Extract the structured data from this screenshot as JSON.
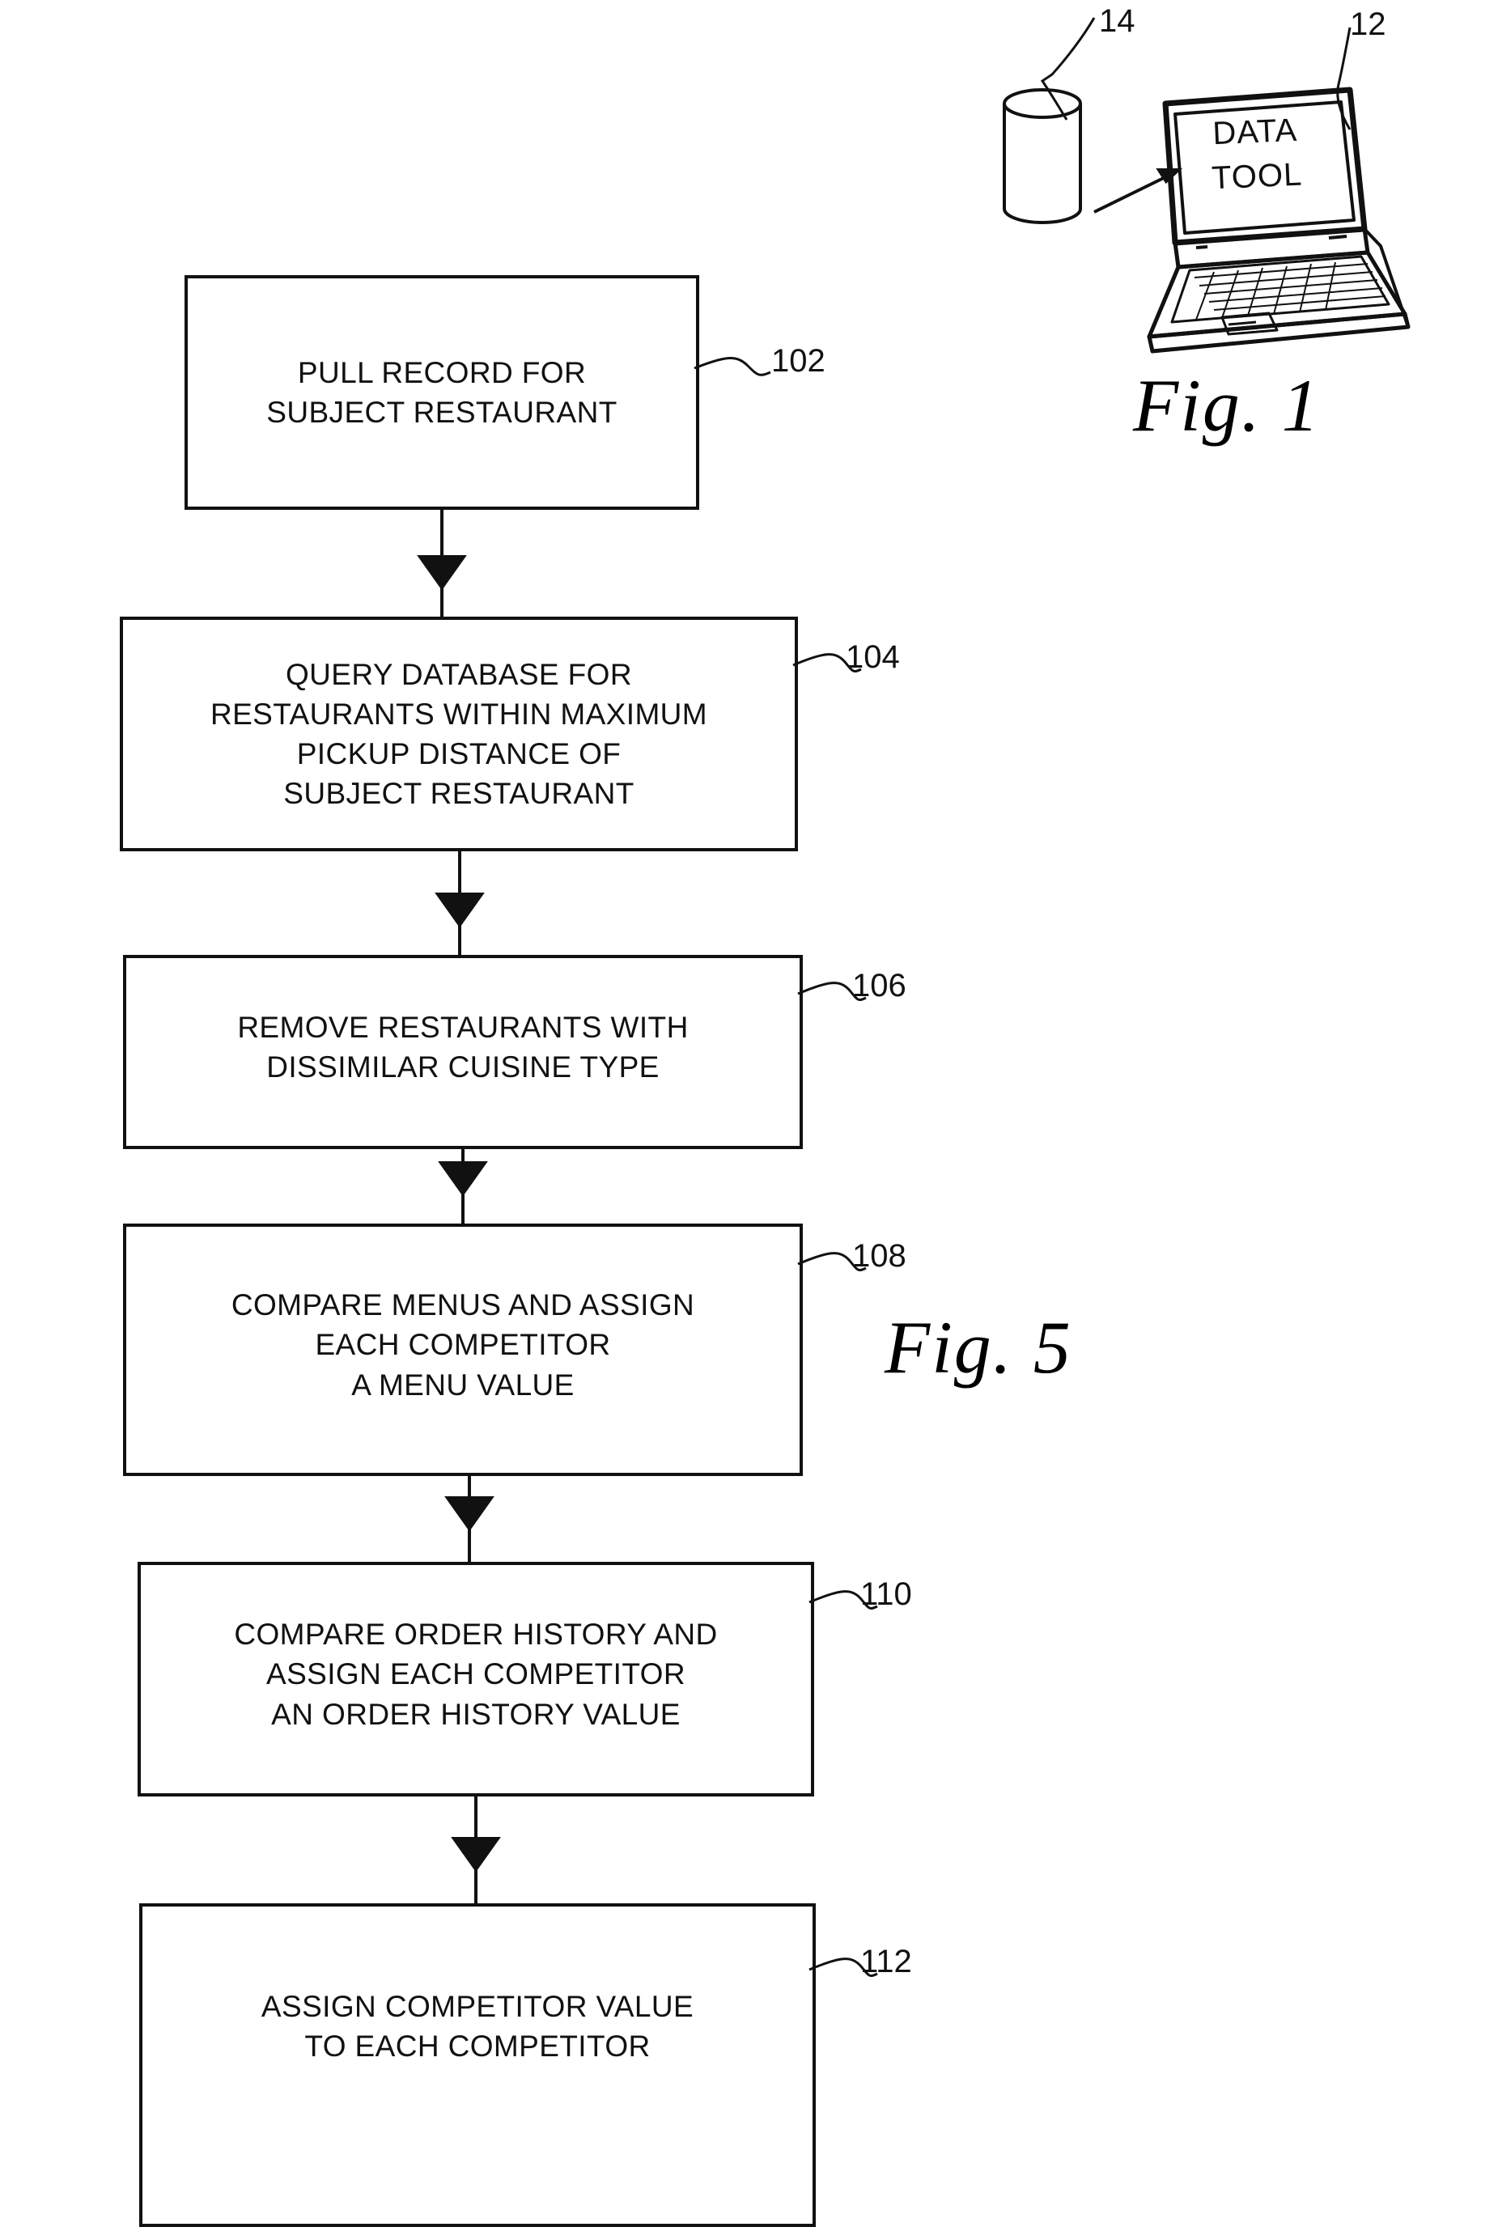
{
  "figure": {
    "sheet_label": "patent-figure-sheet",
    "captions": {
      "fig1": "Fig. 1",
      "fig5": "Fig. 5"
    }
  },
  "fig1": {
    "device_label": "DATA\nTOOL",
    "database_numeral": "14",
    "computer_numeral": "12",
    "icons": {
      "database": "database-cylinder-icon",
      "computer": "laptop-computer-icon",
      "link_arrow": "database-to-laptop-arrow-icon"
    }
  },
  "fig5": {
    "title": "Fig. 5",
    "steps": [
      {
        "numeral": "102",
        "text": "PULL RECORD FOR\nSUBJECT RESTAURANT"
      },
      {
        "numeral": "104",
        "text": "QUERY DATABASE FOR\nRESTAURANTS WITHIN MAXIMUM\nPICKUP DISTANCE OF\nSUBJECT RESTAURANT"
      },
      {
        "numeral": "106",
        "text": "REMOVE RESTAURANTS WITH\nDISSIMILAR CUISINE TYPE"
      },
      {
        "numeral": "108",
        "text": "COMPARE MENUS AND ASSIGN\nEACH COMPETITOR\nA MENU VALUE"
      },
      {
        "numeral": "110",
        "text": "COMPARE ORDER HISTORY AND\nASSIGN EACH COMPETITOR\nAN ORDER HISTORY VALUE"
      },
      {
        "numeral": "112",
        "text": "ASSIGN COMPETITOR VALUE\nTO EACH COMPETITOR"
      }
    ],
    "connector_icons": [
      "down-arrow-icon",
      "down-arrow-icon",
      "down-arrow-icon",
      "down-arrow-icon",
      "down-arrow-icon"
    ]
  },
  "colors": {
    "ink": "#111111",
    "paper": "#ffffff"
  }
}
